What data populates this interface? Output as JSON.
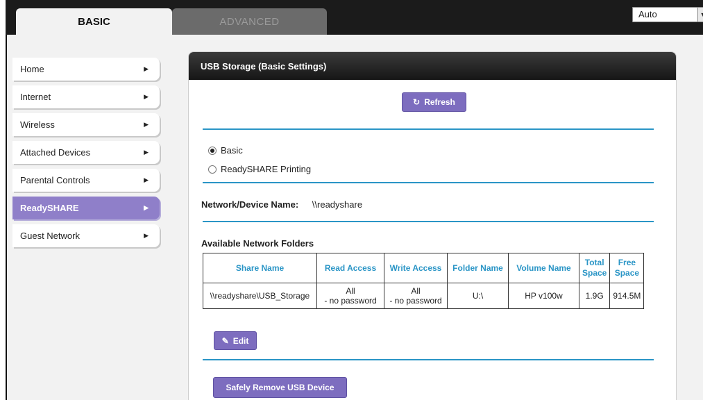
{
  "tabs": {
    "basic": "BASIC",
    "advanced": "ADVANCED"
  },
  "language": {
    "selected": "Auto"
  },
  "sidebar": {
    "items": [
      {
        "label": "Home"
      },
      {
        "label": "Internet"
      },
      {
        "label": "Wireless"
      },
      {
        "label": "Attached Devices"
      },
      {
        "label": "Parental Controls"
      },
      {
        "label": "ReadySHARE",
        "active": true
      },
      {
        "label": "Guest Network"
      }
    ]
  },
  "panel": {
    "title": "USB Storage (Basic Settings)",
    "refresh_label": "Refresh",
    "mode_options": [
      {
        "label": "Basic",
        "selected": true
      },
      {
        "label": "ReadySHARE Printing",
        "selected": false
      }
    ],
    "device_name_label": "Network/Device Name:",
    "device_name_value": "\\\\readyshare",
    "folders_title": "Available Network Folders",
    "table": {
      "headers": [
        "Share Name",
        "Read Access",
        "Write Access",
        "Folder Name",
        "Volume Name",
        "Total Space",
        "Free Space"
      ],
      "rows": [
        {
          "share_name": "\\\\readyshare\\USB_Storage",
          "read_access_line1": "All",
          "read_access_line2": "- no password",
          "write_access_line1": "All",
          "write_access_line2": "- no password",
          "folder_name": "U:\\",
          "volume_name": "HP v100w",
          "total_space": "1.9G",
          "free_space": "914.5M"
        }
      ]
    },
    "edit_label": "Edit",
    "remove_label": "Safely Remove USB Device"
  },
  "colors": {
    "accent": "#7d6dbf",
    "rule": "#2a95c6",
    "active_menu": "#8f7fc9"
  }
}
